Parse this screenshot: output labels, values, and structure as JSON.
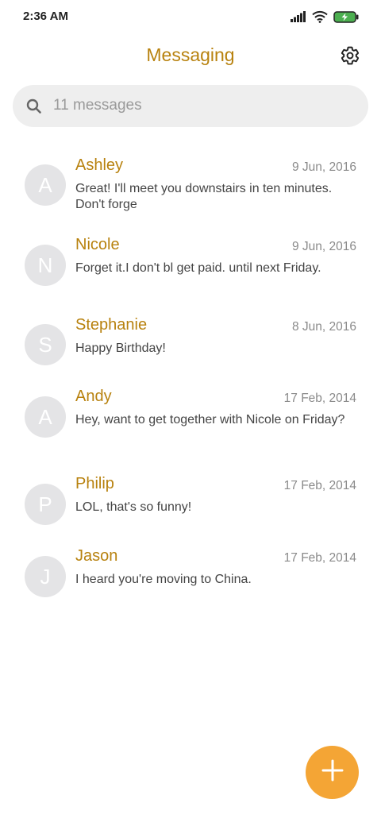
{
  "status_bar": {
    "time": "2:36 AM",
    "icons": [
      "signal-icon",
      "wifi-icon",
      "battery-charging-icon"
    ]
  },
  "header": {
    "title": "Messaging",
    "settings_icon": "gear-icon"
  },
  "search": {
    "placeholder": "11 messages",
    "icon": "search-icon"
  },
  "conversations": [
    {
      "initial": "A",
      "name": "Ashley",
      "date": "9 Jun, 2016",
      "preview": "Great! I'll meet you downstairs in ten minutes. Don't forge"
    },
    {
      "initial": "N",
      "name": "Nicole",
      "date": "9 Jun, 2016",
      "preview": "Forget it.I don't bl get paid. until next Friday."
    },
    {
      "initial": "S",
      "name": "Stephanie",
      "date": "8 Jun, 2016",
      "preview": "Happy Birthday!"
    },
    {
      "initial": "A",
      "name": "Andy",
      "date": "17 Feb, 2014",
      "preview": "Hey, want to get together with Nicole on Friday?"
    },
    {
      "initial": "P",
      "name": "Philip",
      "date": "17 Feb, 2014",
      "preview": "LOL, that's so funny!"
    },
    {
      "initial": "J",
      "name": "Jason",
      "date": "17 Feb, 2014",
      "preview": "I heard you're moving to China."
    }
  ],
  "fab": {
    "icon": "plus-icon"
  },
  "colors": {
    "accent": "#b8820f",
    "fab": "#f4a535",
    "avatar": "#e4e4e6",
    "search_bg": "#eeeeee",
    "battery": "#4caf50"
  }
}
